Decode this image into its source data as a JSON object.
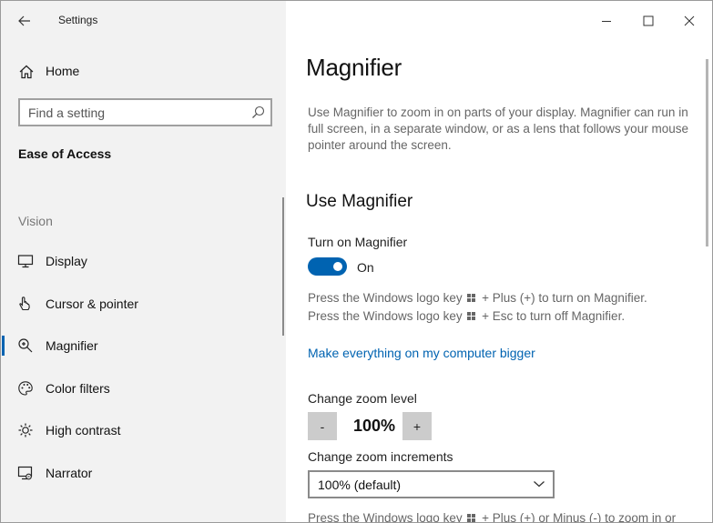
{
  "window": {
    "title": "Settings"
  },
  "sidebar": {
    "home_label": "Home",
    "search_placeholder": "Find a setting",
    "section_title": "Ease of Access",
    "group_label": "Vision",
    "items": [
      {
        "label": "Display",
        "icon": "display-icon",
        "active": false
      },
      {
        "label": "Cursor & pointer",
        "icon": "pointer-icon",
        "active": false
      },
      {
        "label": "Magnifier",
        "icon": "magnifier-icon",
        "active": true
      },
      {
        "label": "Color filters",
        "icon": "color-filters-icon",
        "active": false
      },
      {
        "label": "High contrast",
        "icon": "high-contrast-icon",
        "active": false
      },
      {
        "label": "Narrator",
        "icon": "narrator-icon",
        "active": false
      }
    ]
  },
  "main": {
    "title": "Magnifier",
    "description": "Use Magnifier to zoom in on parts of your display. Magnifier can run in full screen, in a separate window, or as a lens that follows your mouse pointer around the screen.",
    "use_heading": "Use Magnifier",
    "toggle_label": "Turn on Magnifier",
    "toggle_state": "On",
    "hint_on_prefix": "Press the Windows logo key",
    "hint_on_suffix": "+ Plus (+) to turn on Magnifier.",
    "hint_off_prefix": "Press the Windows logo key",
    "hint_off_suffix": "+ Esc to turn off Magnifier.",
    "link_text": "Make everything on my computer bigger",
    "zoom_level_label": "Change zoom level",
    "zoom_minus": "-",
    "zoom_value": "100%",
    "zoom_plus": "+",
    "increments_label": "Change zoom increments",
    "increments_value": "100% (default)",
    "cut_hint_prefix": "Press the Windows logo key",
    "cut_hint_suffix": "+ Plus (+) or Minus (-) to zoom in or"
  },
  "colors": {
    "accent": "#0063b1",
    "sidebar_bg": "#f2f2f2",
    "hint_text": "#666666"
  }
}
